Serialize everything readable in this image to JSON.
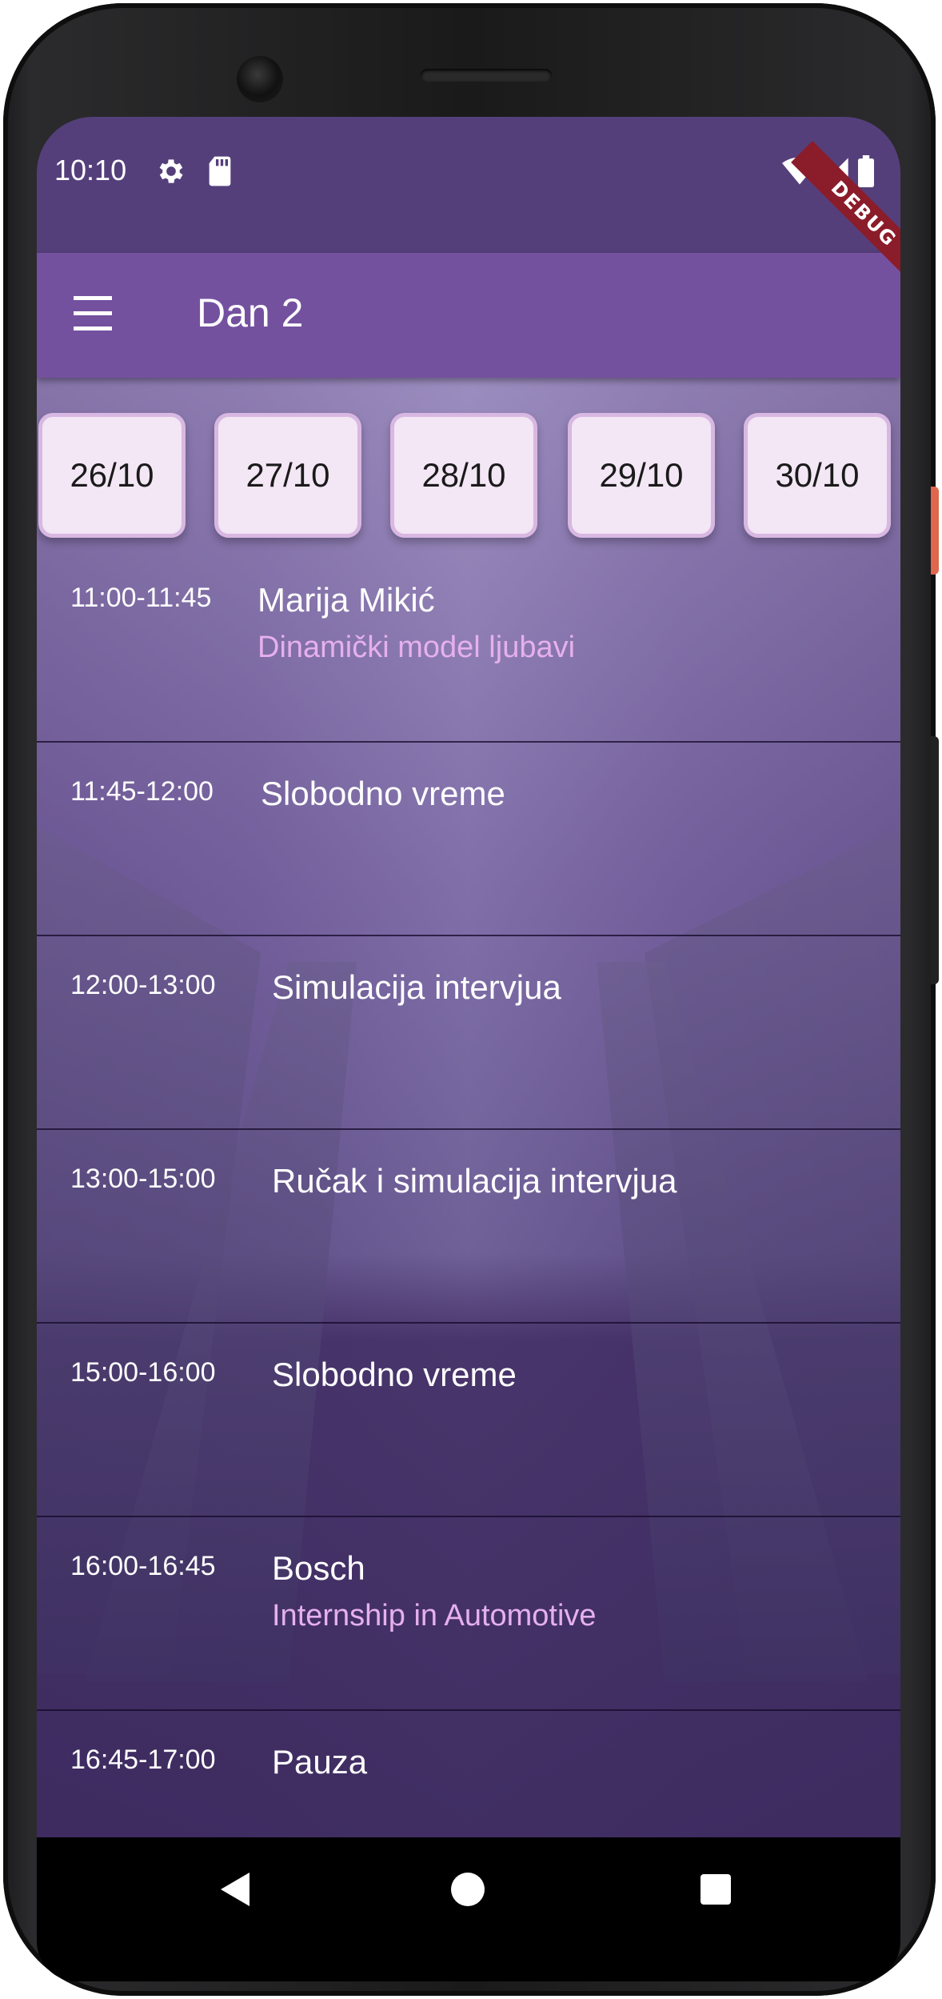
{
  "status_bar": {
    "time": "10:10",
    "debug_banner": "DEBUG"
  },
  "app_bar": {
    "title": "Dan 2"
  },
  "dates": [
    "26/10",
    "27/10",
    "28/10",
    "29/10",
    "30/10"
  ],
  "schedule": [
    {
      "time": "11:00-11:45",
      "title": "Marija Mikić",
      "subtitle": "Dinamički model ljubavi"
    },
    {
      "time": "11:45-12:00",
      "title": "Slobodno vreme",
      "subtitle": ""
    },
    {
      "time": "12:00-13:00",
      "title": "Simulacija intervjua",
      "subtitle": ""
    },
    {
      "time": "13:00-15:00",
      "title": "Ručak i simulacija intervjua",
      "subtitle": ""
    },
    {
      "time": "15:00-16:00",
      "title": "Slobodno vreme",
      "subtitle": ""
    },
    {
      "time": "16:00-16:45",
      "title": "Bosch",
      "subtitle": "Internship in Automotive"
    },
    {
      "time": "16:45-17:00",
      "title": "Pauza",
      "subtitle": ""
    }
  ],
  "colors": {
    "status_bar": "#553f7b",
    "app_bar": "#74519f",
    "date_card": "#f3e6f5",
    "subtitle": "#e6b0ec"
  },
  "icons": [
    "settings-icon",
    "sd-card-icon",
    "wifi-icon",
    "signal-icon",
    "battery-icon",
    "menu-icon",
    "back-icon",
    "home-icon",
    "recents-icon"
  ]
}
